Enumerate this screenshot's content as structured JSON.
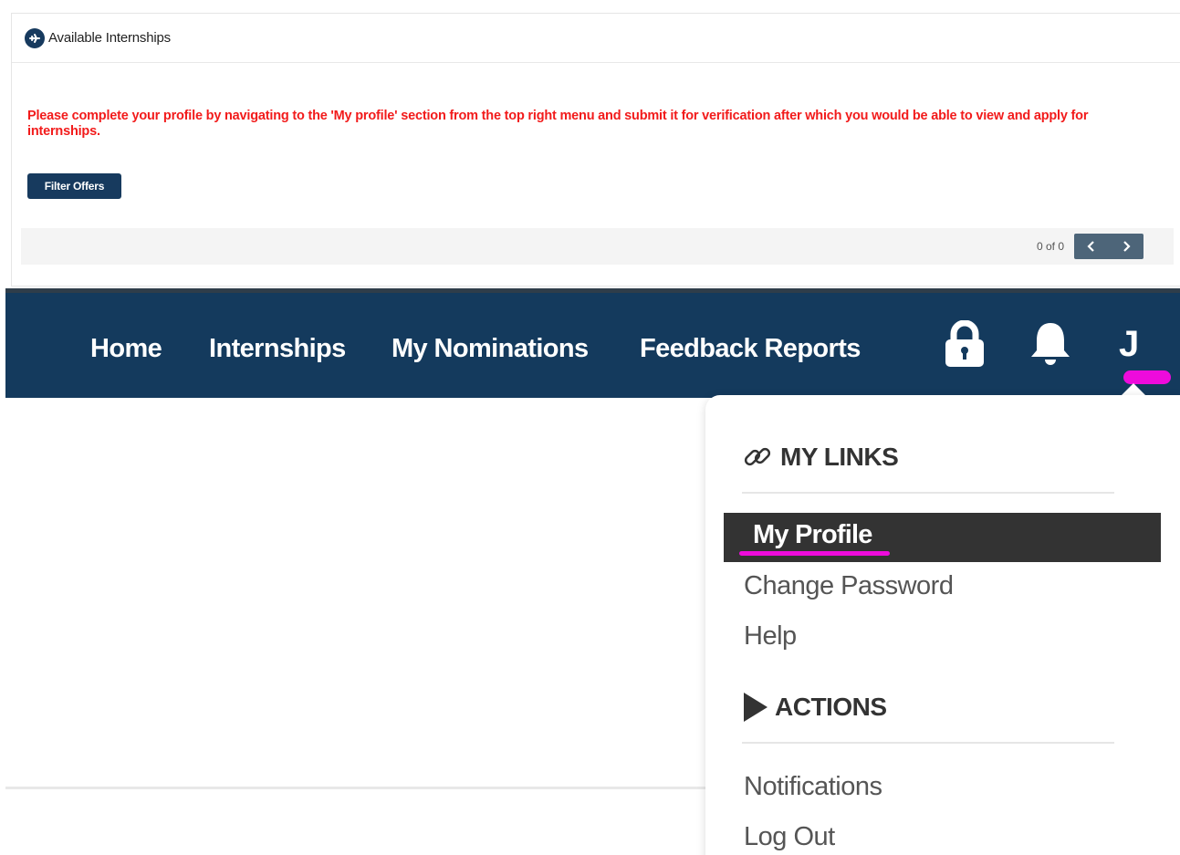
{
  "card": {
    "title": "Available Internships",
    "icon": "plane-circle-icon",
    "warning": "Please complete your profile by navigating to the 'My profile' section from the top right menu and submit it for verification after which you would be able to view and apply for internships.",
    "filter_label": "Filter Offers",
    "pager_count": "0 of 0"
  },
  "nav": {
    "items": [
      {
        "label": "Home"
      },
      {
        "label": "Internships"
      },
      {
        "label": "My Nominations"
      },
      {
        "label": "Feedback Reports"
      }
    ],
    "user_initial": "J",
    "icons": [
      "lock-icon",
      "bell-icon"
    ]
  },
  "dropdown": {
    "links_heading": "MY LINKS",
    "links": [
      {
        "label": "My Profile",
        "active": true
      },
      {
        "label": "Change Password"
      },
      {
        "label": "Help"
      }
    ],
    "actions_heading": "ACTIONS",
    "actions": [
      {
        "label": "Notifications"
      },
      {
        "label": "Log Out"
      }
    ]
  },
  "colors": {
    "nav_bg": "#143a5d",
    "warning_text": "#f21b1b",
    "highlight_marker": "#ee0bdc",
    "active_item_bg": "#333333"
  }
}
